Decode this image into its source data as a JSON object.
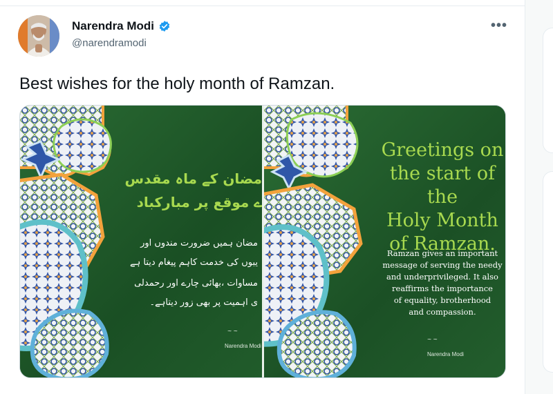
{
  "author": {
    "name": "Narendra Modi",
    "handle": "@narendramodi",
    "verified": true
  },
  "tweet": {
    "text": "Best wishes for the holy month of Ramzan."
  },
  "icons": {
    "more": "more-options-icon",
    "verified": "verified-badge-icon"
  },
  "media": {
    "left_card": {
      "title_lines": [
        "مضان کے ماہ مقدس",
        "ے موقع پر مبارکباد"
      ],
      "body_lines": [
        "مضان ہمیں ضرورت مندوں اور",
        "یبوں کی خدمت کاہم پیغام دیتا ہے",
        "مساوات ،بھائی چارے اور رحمدلی",
        "ی اہمیت پر بھی زور دیتاہے۔"
      ],
      "signature": "Narendra Modi"
    },
    "right_card": {
      "title_lines": [
        "Greetings on",
        "the start of the",
        "Holy Month",
        "of Ramzan."
      ],
      "body_lines": [
        "Ramzan gives an important",
        "message of serving the needy",
        "and underprivileged. It also",
        "reaffirms the importance",
        "of equality, brotherhood",
        "and compassion."
      ],
      "signature": "Narendra Modi"
    }
  },
  "colors": {
    "green_bg": "#1e5a2a",
    "title_green": "#a8d94f",
    "verified_blue": "#1d9bf0",
    "handle_gray": "#536471"
  }
}
